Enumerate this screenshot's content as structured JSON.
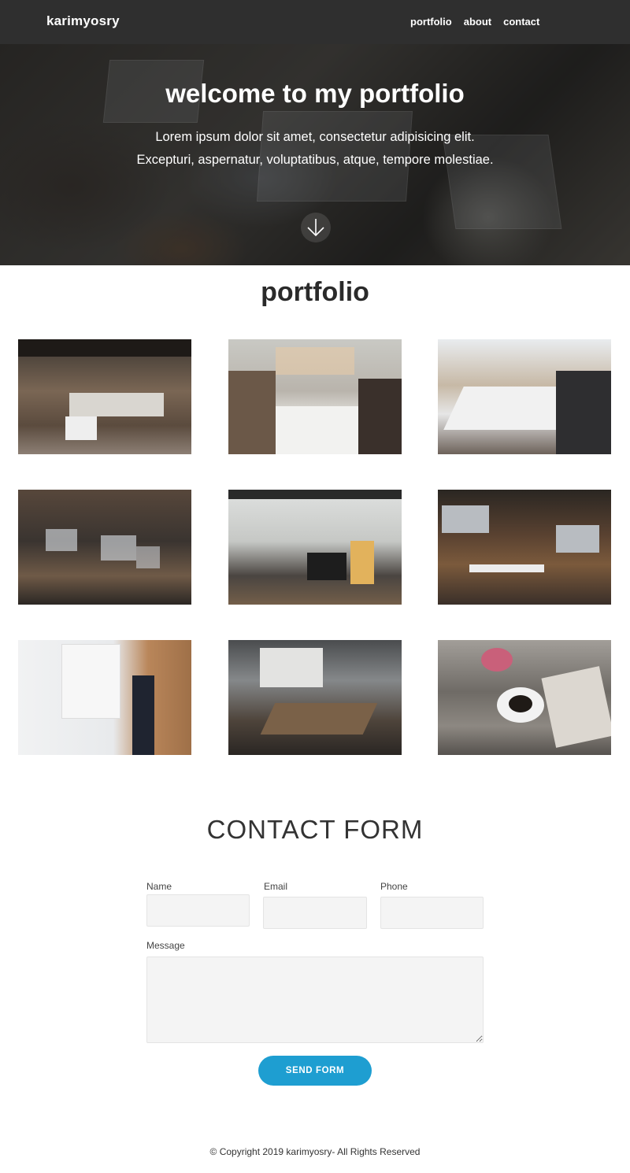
{
  "navbar": {
    "brand": "karimyosry",
    "links": [
      "portfolio",
      "about",
      "contact"
    ]
  },
  "hero": {
    "title": "welcome to my portfolio",
    "subtitle_line1": "Lorem ipsum dolor sit amet, consectetur adipisicing elit.",
    "subtitle_line2": "Excepturi, aspernatur, voluptatibus, atque, tempore molestiae.",
    "scroll_icon": "arrow-down-icon"
  },
  "portfolio": {
    "title": "portfolio",
    "items": [
      {
        "name": "open-office-photo"
      },
      {
        "name": "team-meeting-photo"
      },
      {
        "name": "conference-room-photo"
      },
      {
        "name": "coworking-laptops-photo"
      },
      {
        "name": "desk-window-photo"
      },
      {
        "name": "team-fist-bump-photo"
      },
      {
        "name": "whiteboard-photo"
      },
      {
        "name": "presentation-photo"
      },
      {
        "name": "coffee-magazine-photo"
      }
    ]
  },
  "contact": {
    "title": "CONTACT FORM",
    "name_label": "Name",
    "email_label": "Email",
    "phone_label": "Phone",
    "message_label": "Message",
    "name_value": "",
    "email_value": "",
    "phone_value": "",
    "message_value": "",
    "send_label": "SEND FORM"
  },
  "footer": {
    "copyright": "© Copyright 2019 karimyosry- All Rights Reserved"
  },
  "colors": {
    "navbar": "#2f2f2f",
    "accent": "#1e9ed1"
  }
}
